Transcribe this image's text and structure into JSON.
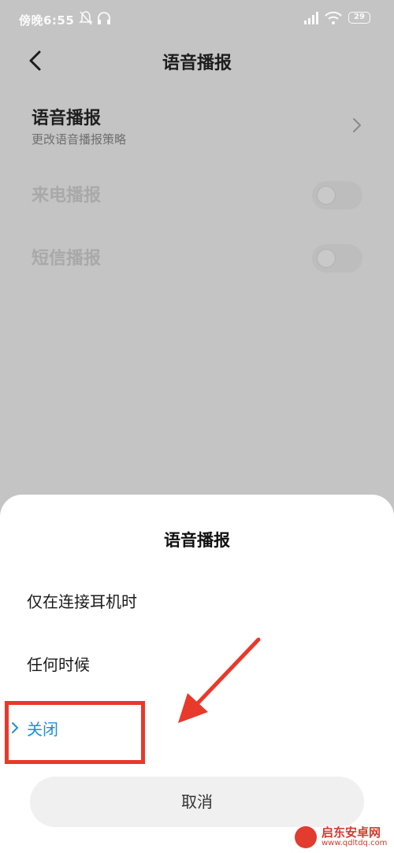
{
  "status_bar": {
    "time": "傍晚6:55",
    "battery": "29"
  },
  "nav": {
    "title": "语音播报"
  },
  "settings": {
    "voice_title": "语音播报",
    "voice_subtitle": "更改语音播报策略",
    "call_label": "来电播报",
    "call_enabled": false,
    "sms_label": "短信播报",
    "sms_enabled": false
  },
  "sheet": {
    "title": "语音播报",
    "options": [
      {
        "label": "仅在连接耳机时",
        "selected": false
      },
      {
        "label": "任何时候",
        "selected": false
      },
      {
        "label": "关闭",
        "selected": true
      }
    ],
    "cancel_label": "取消"
  },
  "watermark": {
    "name": "启东安卓网",
    "url": "www.qdltdq.com"
  },
  "colors": {
    "accent": "#1f8fd7",
    "annotation": "#e8392b",
    "dim_background": "#c4c4c4",
    "sheet_background": "#ffffff"
  },
  "icons": [
    "back-icon",
    "chevron-right-icon",
    "check-icon",
    "bell-off-icon",
    "headset-icon",
    "signal-icon",
    "wifi-icon",
    "battery-icon"
  ]
}
